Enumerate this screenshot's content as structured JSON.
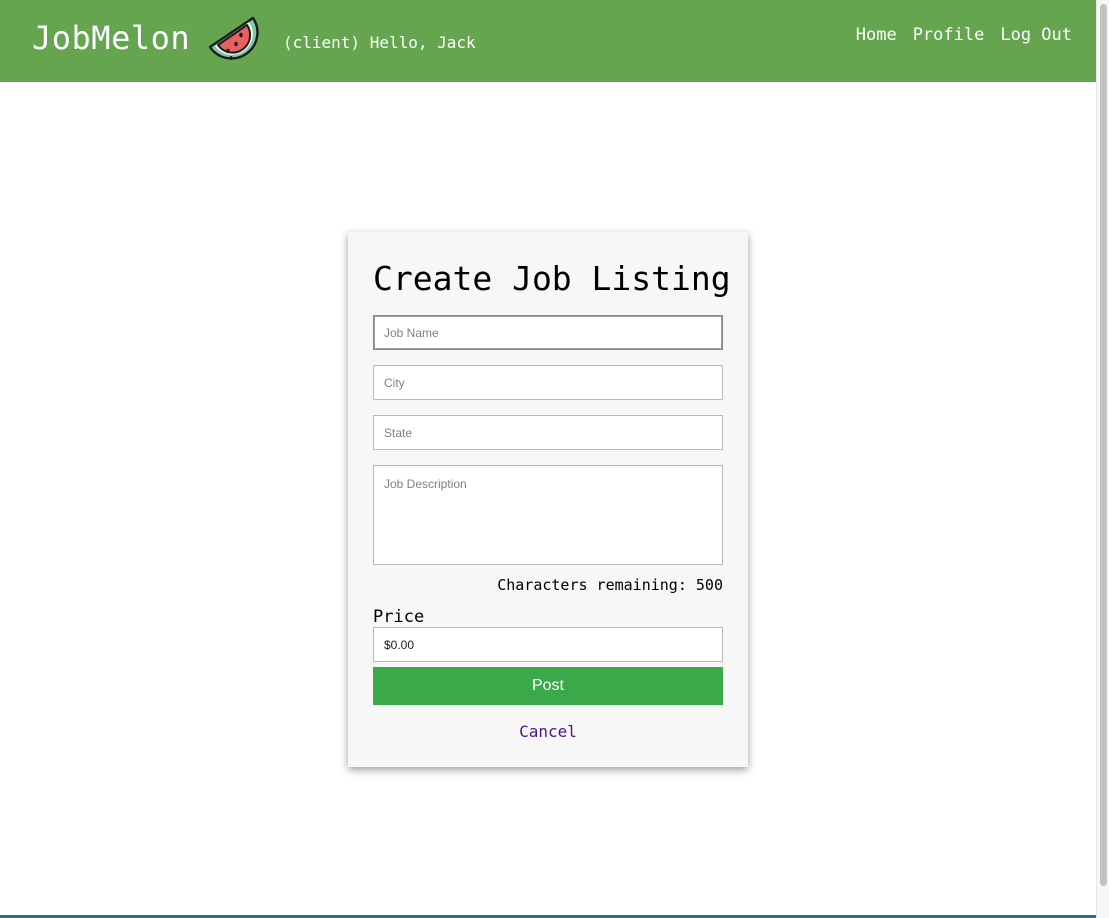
{
  "header": {
    "brand": "JobMelon",
    "greeting": "(client) Hello, Jack",
    "nav": [
      {
        "label": "Home"
      },
      {
        "label": "Profile"
      },
      {
        "label": "Log Out"
      }
    ],
    "logo_icon": "watermelon-slice-icon",
    "background_color": "#65a550"
  },
  "form": {
    "title": "Create Job Listing",
    "job_name": {
      "placeholder": "Job Name",
      "value": ""
    },
    "city": {
      "placeholder": "City",
      "value": ""
    },
    "state": {
      "placeholder": "State",
      "value": ""
    },
    "description": {
      "placeholder": "Job Description",
      "value": ""
    },
    "chars_remaining": "Characters remaining: 500",
    "price_label": "Price",
    "price_value": "$0.00",
    "post_label": "Post",
    "cancel_label": "Cancel",
    "post_color": "#3aa949",
    "cancel_color": "#4b1789"
  }
}
